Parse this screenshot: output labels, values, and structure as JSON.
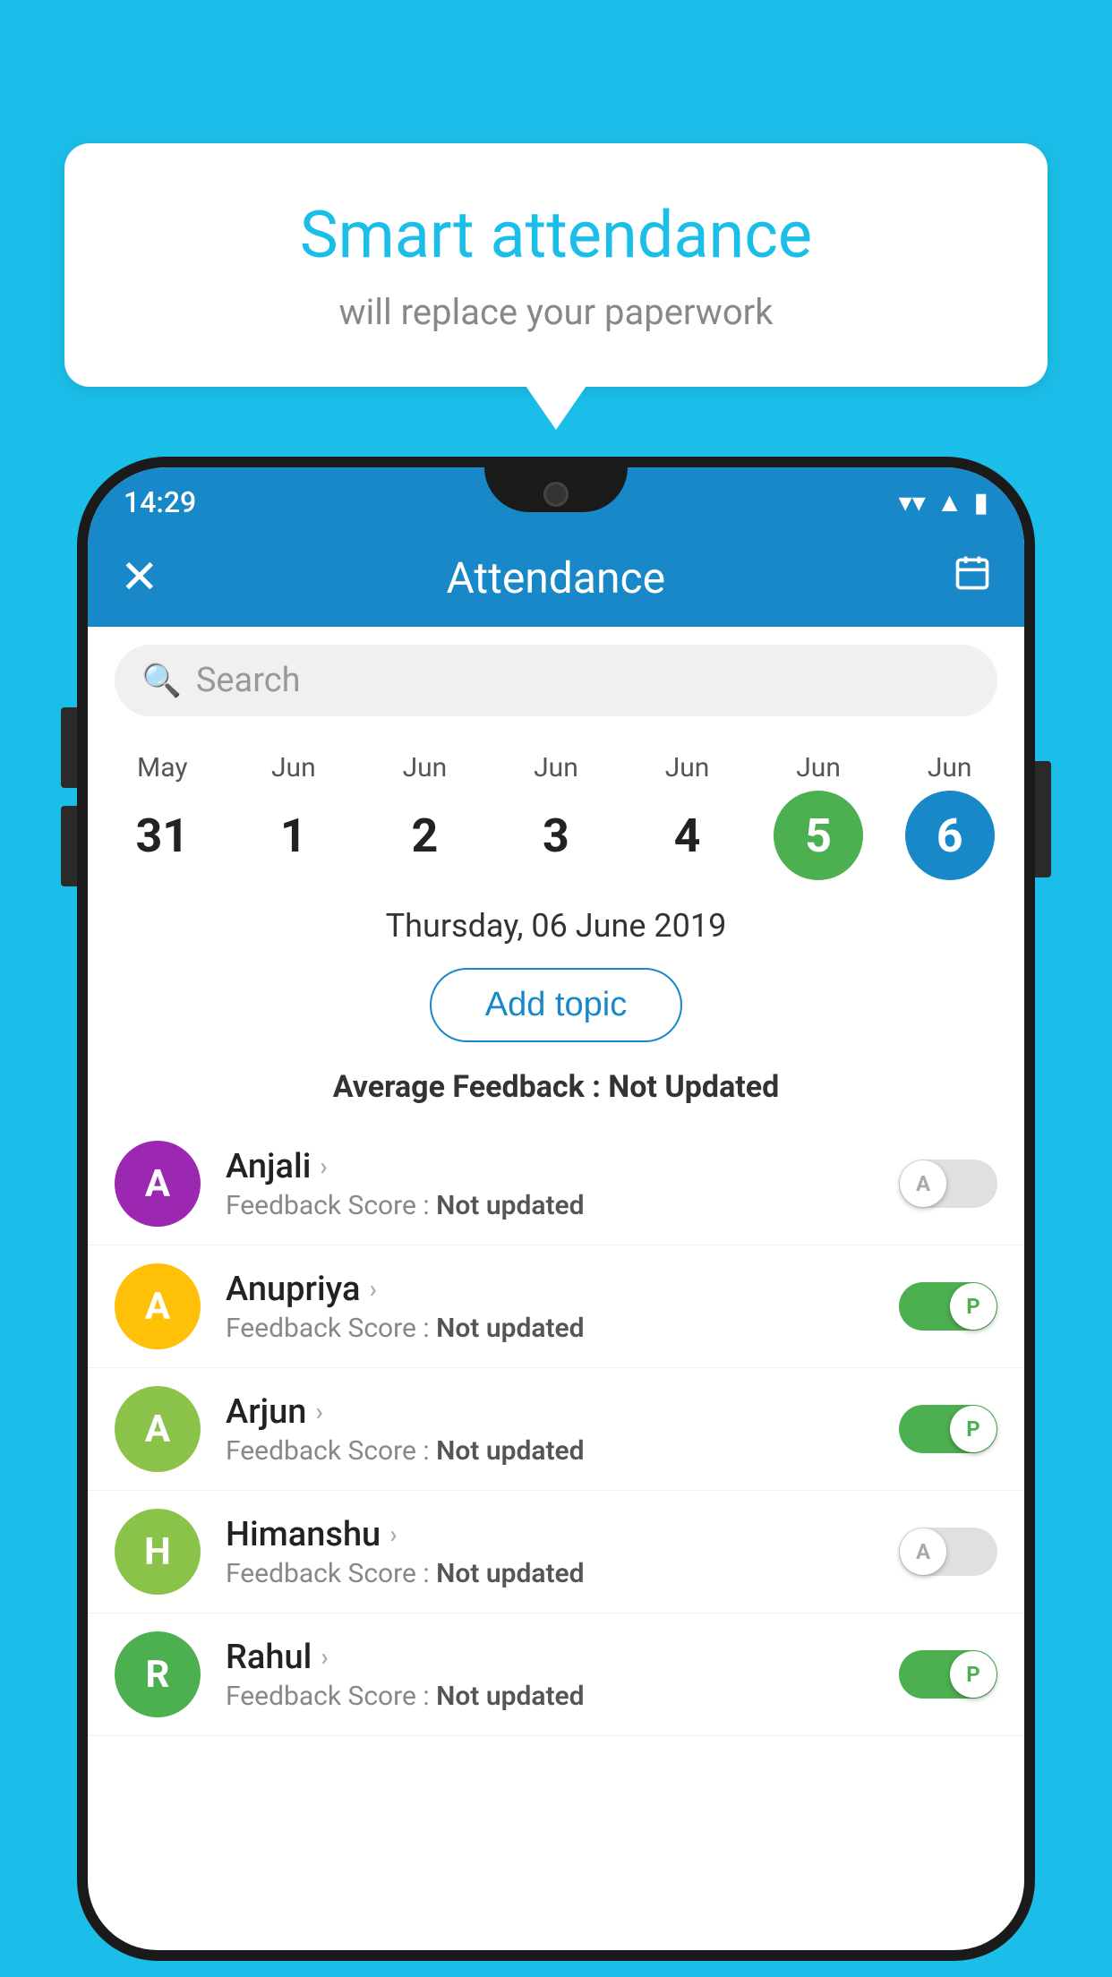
{
  "background_color": "#1BBEE8",
  "bubble": {
    "title": "Smart attendance",
    "subtitle": "will replace your paperwork"
  },
  "status_bar": {
    "time": "14:29",
    "wifi": "▼",
    "signal": "▲",
    "battery": "▮"
  },
  "app_bar": {
    "close_label": "✕",
    "title": "Attendance",
    "calendar_icon": "📅"
  },
  "search": {
    "placeholder": "Search"
  },
  "calendar": {
    "days": [
      {
        "month": "May",
        "date": "31",
        "state": "normal"
      },
      {
        "month": "Jun",
        "date": "1",
        "state": "normal"
      },
      {
        "month": "Jun",
        "date": "2",
        "state": "normal"
      },
      {
        "month": "Jun",
        "date": "3",
        "state": "normal"
      },
      {
        "month": "Jun",
        "date": "4",
        "state": "normal"
      },
      {
        "month": "Jun",
        "date": "5",
        "state": "today"
      },
      {
        "month": "Jun",
        "date": "6",
        "state": "selected"
      }
    ]
  },
  "selected_date": "Thursday, 06 June 2019",
  "add_topic_label": "Add topic",
  "feedback_label": "Average Feedback :",
  "feedback_value": "Not Updated",
  "students": [
    {
      "name": "Anjali",
      "avatar_letter": "A",
      "avatar_color": "#9C27B0",
      "feedback": "Feedback Score :",
      "feedback_value": "Not updated",
      "attendance": "A",
      "status": "off"
    },
    {
      "name": "Anupriya",
      "avatar_letter": "A",
      "avatar_color": "#FFC107",
      "feedback": "Feedback Score :",
      "feedback_value": "Not updated",
      "attendance": "P",
      "status": "on"
    },
    {
      "name": "Arjun",
      "avatar_letter": "A",
      "avatar_color": "#8BC34A",
      "feedback": "Feedback Score :",
      "feedback_value": "Not updated",
      "attendance": "P",
      "status": "on"
    },
    {
      "name": "Himanshu",
      "avatar_letter": "H",
      "avatar_color": "#8BC34A",
      "feedback": "Feedback Score :",
      "feedback_value": "Not updated",
      "attendance": "A",
      "status": "off"
    },
    {
      "name": "Rahul",
      "avatar_letter": "R",
      "avatar_color": "#4CAF50",
      "feedback": "Feedback Score :",
      "feedback_value": "Not updated",
      "attendance": "P",
      "status": "on"
    }
  ]
}
